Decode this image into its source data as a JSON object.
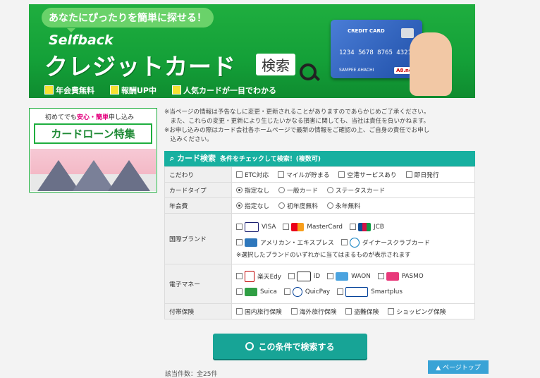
{
  "banner": {
    "tagline": "あなたにぴったりを簡単に探せる！",
    "brand": "Selfback",
    "title": "クレジットカード",
    "search_word": "検索",
    "features": [
      "年会費無料",
      "報酬UP中",
      "人気カードが一目でわかる"
    ],
    "card": {
      "label": "CREDIT CARD",
      "number": "1234 5678 8765 4321",
      "name": "SAMPEE AHACHI",
      "logo": "A8.net"
    }
  },
  "sidebar": {
    "lead": "初めてでも",
    "lead_em": "安心・簡単",
    "lead_tail": "申し込み",
    "headline": "カードローン特集"
  },
  "notes": [
    "※当ページの情報は予告なしに変更・更新されることがありますのであらかじめご了承ください。",
    "　また、これらの変更・更新により生じたいかなる損害に関しても、当社は責任を負いかねます。",
    "※お申し込みの際はカード会社各ホームページで最新の情報をご確認の上、ご自身の責任でお申し",
    "　込みください。"
  ],
  "search": {
    "title": "カード検索",
    "subtitle": "条件をチェックして検索！(複数可)",
    "rows": {
      "kodawari": {
        "label": "こだわり",
        "options": [
          "ETC対応",
          "マイルが貯まる",
          "空港サービスあり",
          "即日発行"
        ]
      },
      "card_type": {
        "label": "カードタイプ",
        "options": [
          "指定なし",
          "一般カード",
          "ステータスカード"
        ],
        "selected": "指定なし"
      },
      "annual_fee": {
        "label": "年会費",
        "options": [
          "指定なし",
          "初年度無料",
          "永年無料"
        ],
        "selected": "指定なし"
      },
      "brand": {
        "label": "国際ブランド",
        "options": [
          "VISA",
          "MasterCard",
          "JCB",
          "アメリカン・エキスプレス",
          "ダイナースクラブカード"
        ],
        "hint": "※選択したブランドのいずれかに当てはまるものが表示されます"
      },
      "emoney": {
        "label": "電子マネー",
        "options": [
          "楽天Edy",
          "iD",
          "WAON",
          "PASMO",
          "Suica",
          "QuicPay",
          "Smartplus"
        ]
      },
      "insurance": {
        "label": "付帯保険",
        "options": [
          "国内旅行保険",
          "海外旅行保険",
          "盗難保険",
          "ショッピング保険"
        ]
      }
    },
    "submit_label": "この条件で検索する"
  },
  "page_top_label": "▲ ページトップ",
  "result_count": "該当件数：全25件"
}
